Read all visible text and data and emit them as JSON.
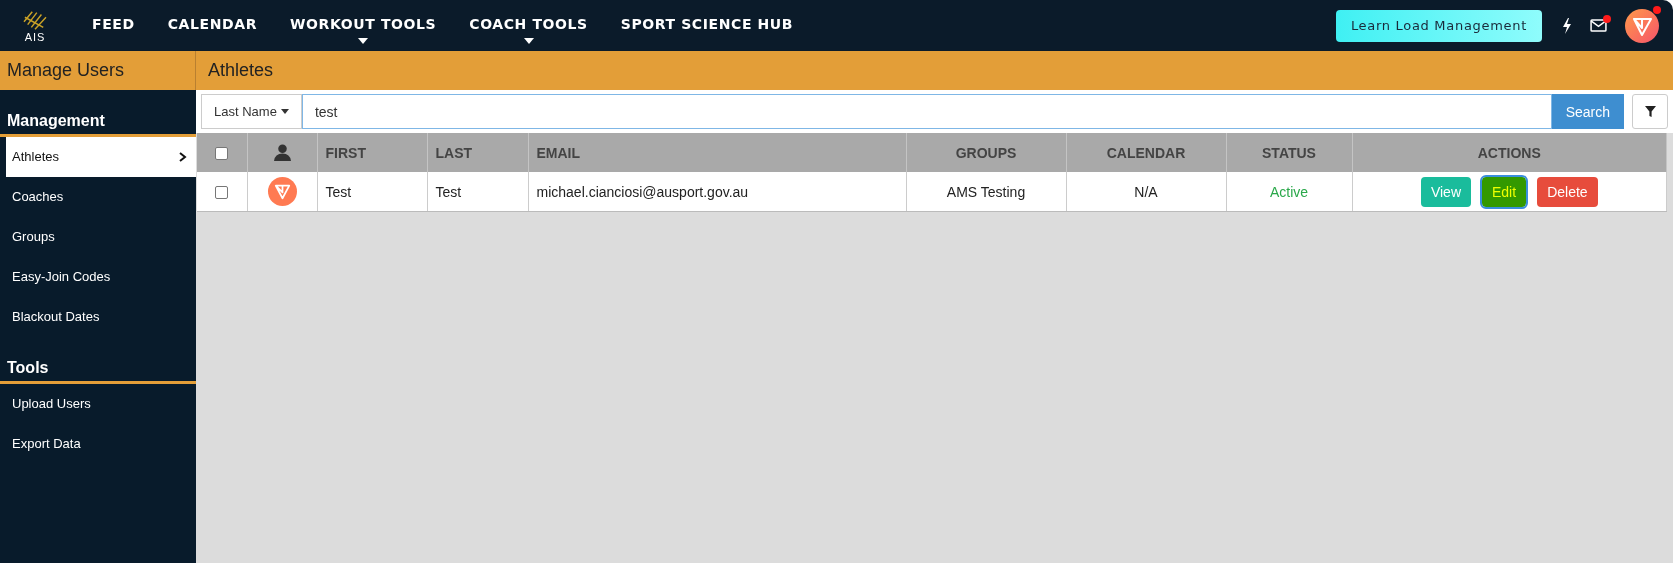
{
  "header": {
    "logo_text": "AIS",
    "nav": [
      {
        "label": "FEED",
        "dropdown": false
      },
      {
        "label": "CALENDAR",
        "dropdown": false
      },
      {
        "label": "WORKOUT TOOLS",
        "dropdown": true
      },
      {
        "label": "COACH TOOLS",
        "dropdown": true
      },
      {
        "label": "SPORT SCIENCE HUB",
        "dropdown": false
      }
    ],
    "cta": "Learn Load Management",
    "mail_unread": true,
    "avatar_unread": true
  },
  "sidebar": {
    "title": "Manage Users",
    "sections": [
      {
        "heading": "Management",
        "items": [
          {
            "label": "Athletes",
            "selected": true
          },
          {
            "label": "Coaches",
            "selected": false
          },
          {
            "label": "Groups",
            "selected": false
          },
          {
            "label": "Easy-Join Codes",
            "selected": false
          },
          {
            "label": "Blackout Dates",
            "selected": false
          }
        ]
      },
      {
        "heading": "Tools",
        "items": [
          {
            "label": "Upload Users",
            "selected": false
          },
          {
            "label": "Export Data",
            "selected": false
          }
        ]
      }
    ]
  },
  "main": {
    "title": "Athletes",
    "search": {
      "field": "Last Name",
      "value": "test",
      "button": "Search"
    },
    "table": {
      "select_all": false,
      "columns": [
        "FIRST",
        "LAST",
        "EMAIL",
        "GROUPS",
        "CALENDAR",
        "STATUS",
        "ACTIONS"
      ],
      "rows": [
        {
          "checked": false,
          "first": "Test",
          "last": "Test",
          "email": "michael.cianciosi@ausport.gov.au",
          "groups": "AMS Testing",
          "calendar": "N/A",
          "status": "Active",
          "actions": [
            {
              "label": "View",
              "kind": "view"
            },
            {
              "label": "Edit",
              "kind": "edit"
            },
            {
              "label": "Delete",
              "kind": "delete"
            }
          ]
        }
      ]
    }
  }
}
